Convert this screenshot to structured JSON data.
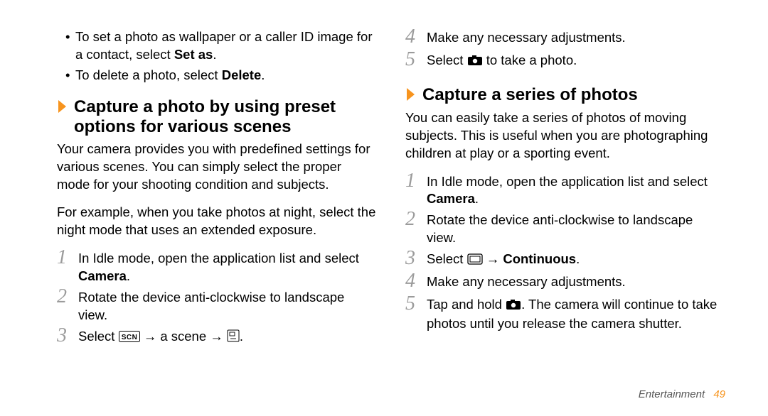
{
  "left": {
    "bullets": {
      "item1_a": "To set a photo as wallpaper or a caller ID image for a contact, select ",
      "item1_bold": "Set as",
      "item1_b": ".",
      "item2_a": "To delete a photo, select ",
      "item2_bold": "Delete",
      "item2_b": "."
    },
    "heading": "Capture a photo by using preset options for various scenes",
    "p1": "Your camera provides you with predefined settings for various scenes. You can simply select the proper mode for your shooting condition and subjects.",
    "p2": "For example, when you take photos at night, select the night mode that uses an extended exposure.",
    "steps": [
      {
        "num": "1",
        "text_a": "In Idle mode, open the application list and select ",
        "bold": "Camera",
        "text_b": "."
      },
      {
        "num": "2",
        "text_a": "Rotate the device anti-clockwise to landscape view.",
        "bold": "",
        "text_b": ""
      },
      {
        "num": "3",
        "text_a": "Select ",
        "bold": "",
        "text_b": ""
      }
    ],
    "step3_after_icon1": " → a scene → ",
    "step3_after_icon2": "."
  },
  "right": {
    "steps_cont": [
      {
        "num": "4",
        "text_a": "Make any necessary adjustments.",
        "bold": "",
        "text_b": ""
      },
      {
        "num": "5",
        "text_a": "Select ",
        "bold": "",
        "text_b": " to take a photo."
      }
    ],
    "heading": "Capture a series of photos",
    "p1": "You can easily take a series of photos of moving subjects. This is useful when you are photographing children at play or a sporting event.",
    "steps": [
      {
        "num": "1",
        "text_a": "In Idle mode, open the application list and select ",
        "bold": "Camera",
        "text_b": "."
      },
      {
        "num": "2",
        "text_a": "Rotate the device anti-clockwise to landscape view.",
        "bold": "",
        "text_b": ""
      },
      {
        "num": "3",
        "text_a": "Select ",
        "mid": " → ",
        "bold": "Continuous",
        "text_b": "."
      },
      {
        "num": "4",
        "text_a": "Make any necessary adjustments.",
        "bold": "",
        "text_b": ""
      },
      {
        "num": "5",
        "text_a": "Tap and hold ",
        "text_b": ". The camera will continue to take photos until you release the camera shutter."
      }
    ]
  },
  "footer": {
    "section": "Entertainment",
    "page": "49"
  }
}
